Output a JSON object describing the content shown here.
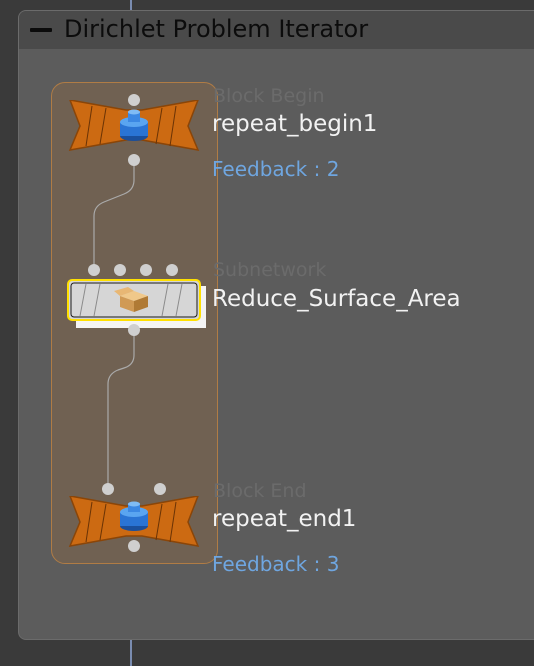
{
  "network_box": {
    "title": "Dirichlet Problem Iterator",
    "collapse_icon": "minus-icon"
  },
  "nodes": [
    {
      "type_label": "Block Begin",
      "name": "repeat_begin1",
      "feedback": "Feedback : 2",
      "icon": "blue-block-icon",
      "color": "#cc6a12"
    },
    {
      "type_label": "Subnetwork",
      "name": "Reduce_Surface_Area",
      "icon": "box-package-icon",
      "color": "#d4d4d4"
    },
    {
      "type_label": "Block End",
      "name": "repeat_end1",
      "feedback": "Feedback : 3",
      "icon": "blue-block-icon",
      "color": "#cc6a12"
    }
  ],
  "colors": {
    "background": "#3a3a3a",
    "network_box": "#5c5c5c",
    "block_frame": "#b07c45",
    "feedback_text": "#6fa6e0",
    "wire": "#8fa8d8"
  }
}
